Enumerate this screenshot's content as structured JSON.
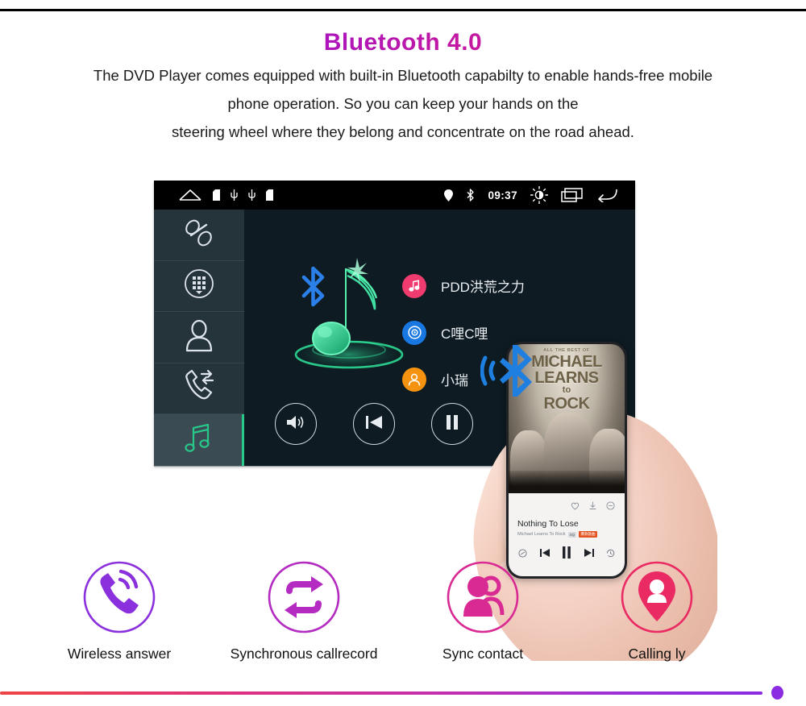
{
  "heading": "Bluetooth 4.0",
  "paragraph_lines": [
    "The DVD Player comes equipped with built-in Bluetooth capabilty to enable hands-free mobile",
    "phone operation. So you can keep your hands on the",
    "steering wheel where they belong and concentrate on the road ahead."
  ],
  "colors": {
    "heading_start": "#8a12d6",
    "heading_end": "#e8225f",
    "accent_green": "#27c98a",
    "bluetooth_blue": "#1f7fe0",
    "screen_bg": "#0e1b22",
    "sidebar_bg": "#25333b",
    "statusbar_bg": "#000000"
  },
  "headunit": {
    "statusbar": {
      "left_icons": [
        "home-icon",
        "sdcard-icon",
        "usb-icon",
        "usb-icon",
        "sdcard-icon"
      ],
      "right_icons": [
        "location-pin-icon",
        "bluetooth-icon"
      ],
      "clock": "09:37",
      "trailing_icons": [
        "brightness-icon",
        "recent-apps-icon",
        "back-icon"
      ]
    },
    "sidebar": [
      {
        "name": "sidebar-item-pair",
        "icon": "link-pair-icon",
        "active": false
      },
      {
        "name": "sidebar-item-dialpad",
        "icon": "dialpad-icon",
        "active": false
      },
      {
        "name": "sidebar-item-contacts",
        "icon": "contact-person-icon",
        "active": false
      },
      {
        "name": "sidebar-item-callrecord",
        "icon": "call-transfer-icon",
        "active": false
      },
      {
        "name": "sidebar-item-music",
        "icon": "music-note-icon",
        "active": true
      }
    ],
    "artwork": {
      "icon": "glowing-music-note",
      "badge_icon": "bluetooth-icon"
    },
    "playlist": [
      {
        "title": "PDD洪荒之力",
        "icon": "music-note-icon",
        "color": "#ef3b6e"
      },
      {
        "title": "C哩C哩",
        "icon": "disc-icon",
        "color": "#1877e0"
      },
      {
        "title": "小瑞",
        "icon": "person-icon",
        "color": "#f59311"
      }
    ],
    "transport": [
      {
        "name": "volume-button",
        "icon": "speaker-icon"
      },
      {
        "name": "previous-button",
        "icon": "skip-previous-icon"
      },
      {
        "name": "pause-button",
        "icon": "pause-icon"
      },
      {
        "name": "next-button",
        "icon": "skip-next-icon"
      }
    ]
  },
  "phone": {
    "album_top_line": "ALL THE BEST OF",
    "album_artist_line1": "MICHAEL",
    "album_artist_line2": "LEARNS",
    "album_artist_line3": "to",
    "album_artist_line4": "ROCK",
    "song_title": "Nothing To Lose",
    "song_artist": "Michael Learns To Rock",
    "quality_tag": "SQ",
    "hot_tag": "爆款歌曲",
    "action_icons": [
      "heart-icon",
      "download-icon",
      "minus-circle-icon"
    ],
    "control_icons": [
      "shuffle-icon",
      "skip-previous-icon",
      "pause-icon",
      "skip-next-icon",
      "history-icon"
    ]
  },
  "overlay_icon": "bluetooth-signal-icon",
  "features": [
    {
      "label": "Wireless answer",
      "icon": "phone-ringing-icon",
      "color": "#8b30dd"
    },
    {
      "label": "Synchronous callrecord",
      "icon": "repeat-sync-icon",
      "color": "#b32bc0"
    },
    {
      "label": "Sync contact",
      "icon": "two-people-icon",
      "color": "#d92a94"
    },
    {
      "label": "Calling ly",
      "icon": "person-pin-icon",
      "color": "#ea2a63"
    }
  ],
  "bottom_rule": {
    "start": "#ef4444",
    "end": "#8a2be2"
  }
}
